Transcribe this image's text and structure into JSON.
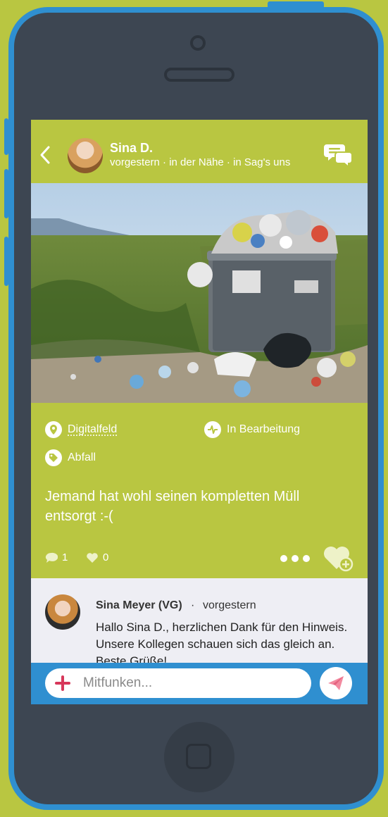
{
  "header": {
    "user_name": "Sina D.",
    "meta": "vorgestern · in der Nähe · in Sag's uns"
  },
  "post": {
    "district": "Digitalfeld",
    "status": "In Bearbeitung",
    "category": "Abfall",
    "text": "Jemand hat wohl seinen kompletten Müll entsorgt :-(",
    "comment_count": "1",
    "like_count": "0"
  },
  "comment": {
    "author": "Sina Meyer (VG)",
    "separator": "·",
    "time": "vorgestern",
    "text": "Hallo Sina D., herzlichen Dank für den Hinweis. Unsere Kollegen schauen sich das gleich an. Beste Grüße!"
  },
  "compose": {
    "placeholder": "Mitfunken..."
  },
  "colors": {
    "accent": "#b9c641",
    "blue": "#2f8fd0",
    "phone": "#3d4652",
    "plus": "#d7375a",
    "send": "#f28aa0"
  }
}
